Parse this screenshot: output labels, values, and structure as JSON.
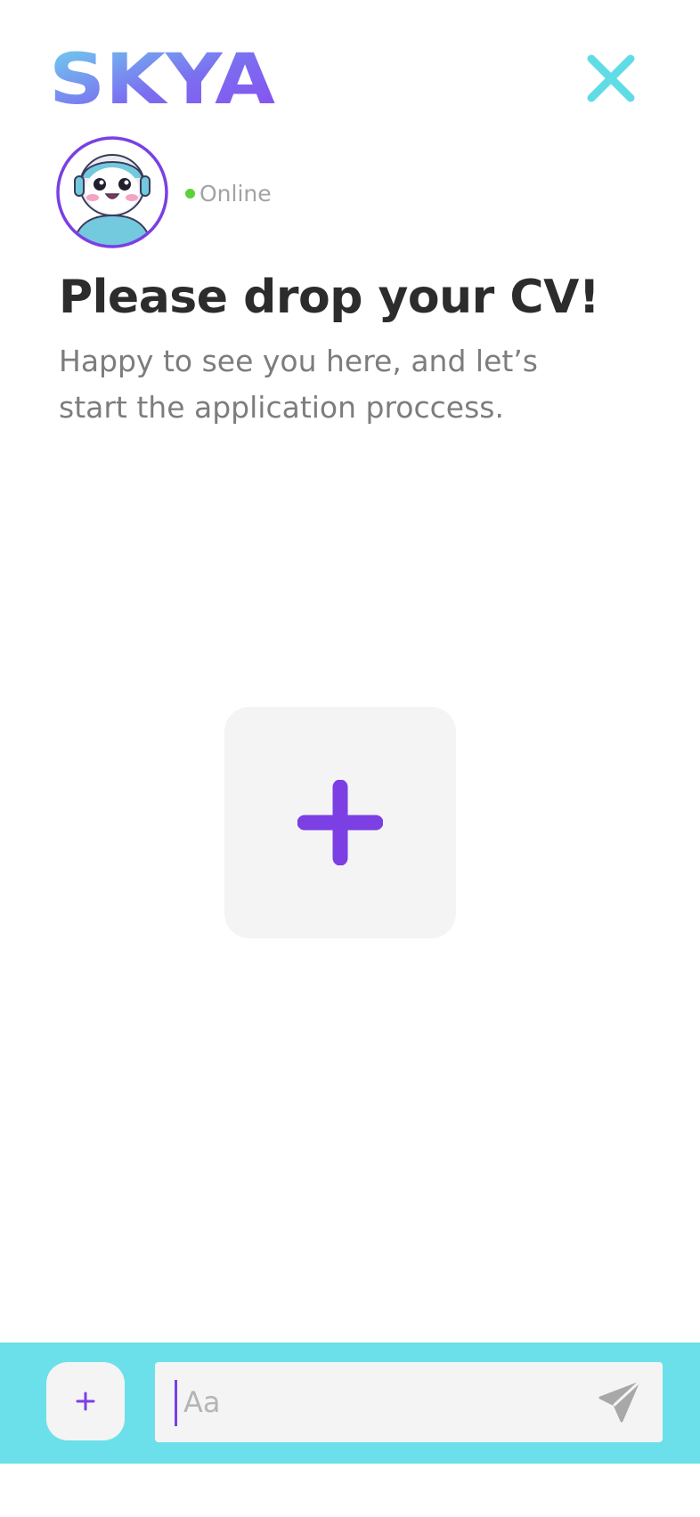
{
  "header": {
    "logo_text": "SKYA",
    "close_icon": "close-icon"
  },
  "bot": {
    "avatar_icon": "robot-avatar",
    "status_text": "Online",
    "status_color": "#5cd13a"
  },
  "main": {
    "title": "Please drop your CV!",
    "subtitle": "Happy to see you here, and let’s start the application proccess.",
    "upload_icon": "plus-icon"
  },
  "composer": {
    "attach_icon": "plus-icon",
    "input_placeholder": "Aa",
    "input_value": "",
    "send_icon": "send-icon"
  },
  "colors": {
    "accent_purple": "#7b3fe4",
    "accent_cyan": "#6be0ea",
    "logo_gradient_start": "#6fd6ee",
    "logo_gradient_end": "#8a4cf1",
    "title_text": "#2c2c2c",
    "subtitle_text": "#7d7d7d"
  }
}
